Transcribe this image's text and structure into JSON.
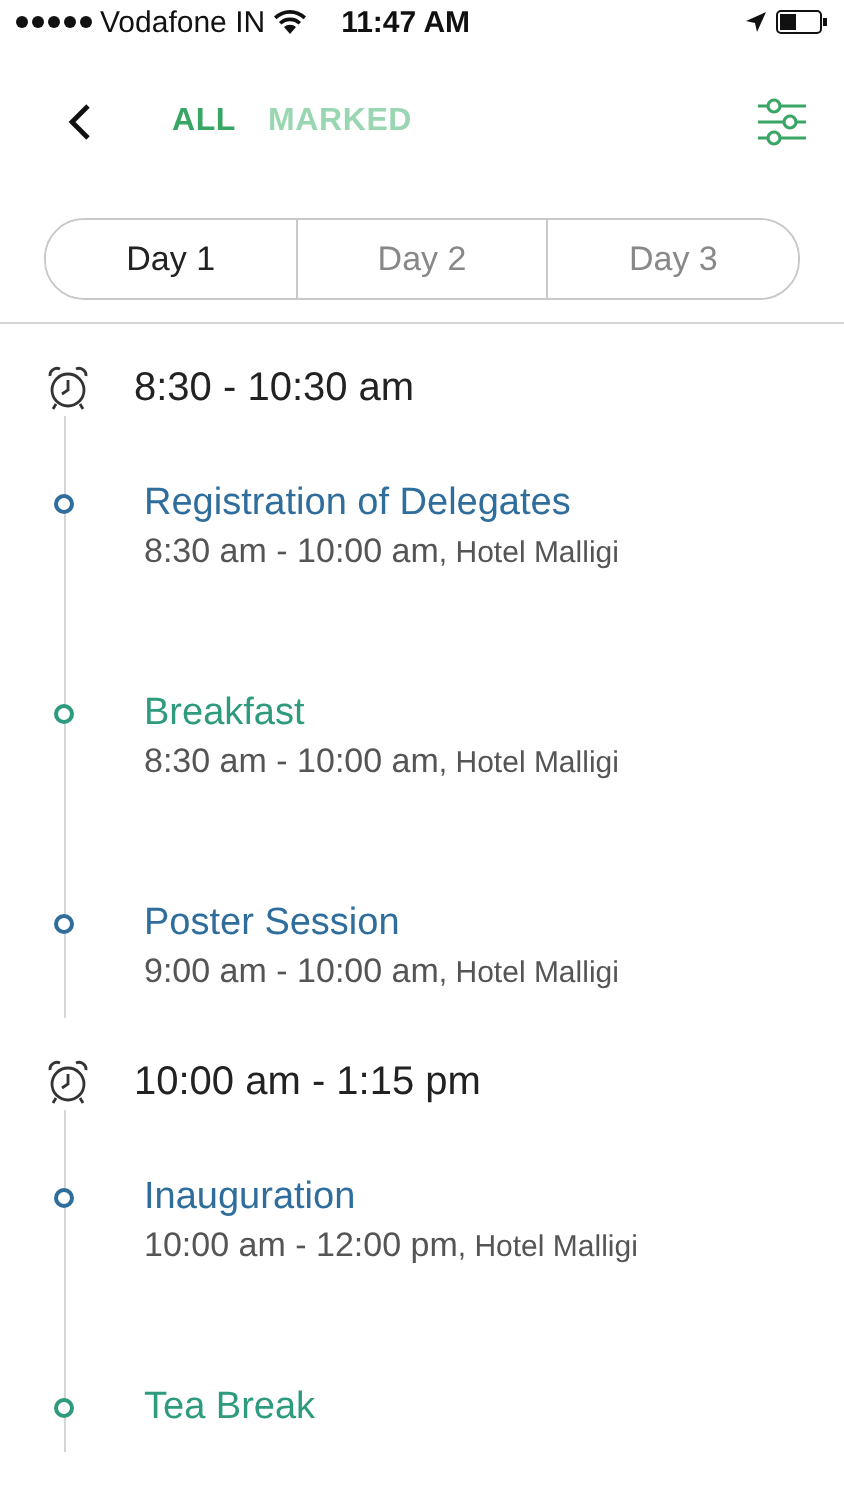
{
  "status_bar": {
    "carrier": "Vodafone IN",
    "time": "11:47 AM"
  },
  "nav": {
    "filters": [
      {
        "label": "ALL",
        "selected": true
      },
      {
        "label": "MARKED",
        "selected": false
      }
    ]
  },
  "day_tabs": [
    {
      "label": "Day 1",
      "selected": true
    },
    {
      "label": "Day 2",
      "selected": false
    },
    {
      "label": "Day 3",
      "selected": false
    }
  ],
  "groups": [
    {
      "time": "8:30 - 10:30 am",
      "events": [
        {
          "title": "Registration of Delegates",
          "time": "8:30 am - 10:00 am",
          "location": ", Hotel Malligi",
          "color": "#2f6e9c"
        },
        {
          "title": "Breakfast",
          "time": "8:30 am - 10:00 am",
          "location": ", Hotel Malligi",
          "color": "#2e9a7e"
        },
        {
          "title": "Poster Session",
          "time": "9:00 am - 10:00 am",
          "location": ", Hotel Malligi",
          "color": "#2f6e9c"
        }
      ]
    },
    {
      "time": "10:00 am - 1:15 pm",
      "events": [
        {
          "title": "Inauguration",
          "time": "10:00 am - 12:00 pm",
          "location": ", Hotel Malligi",
          "color": "#2f6e9c"
        },
        {
          "title": "Tea Break",
          "color": "#2e9a7e"
        }
      ]
    }
  ]
}
